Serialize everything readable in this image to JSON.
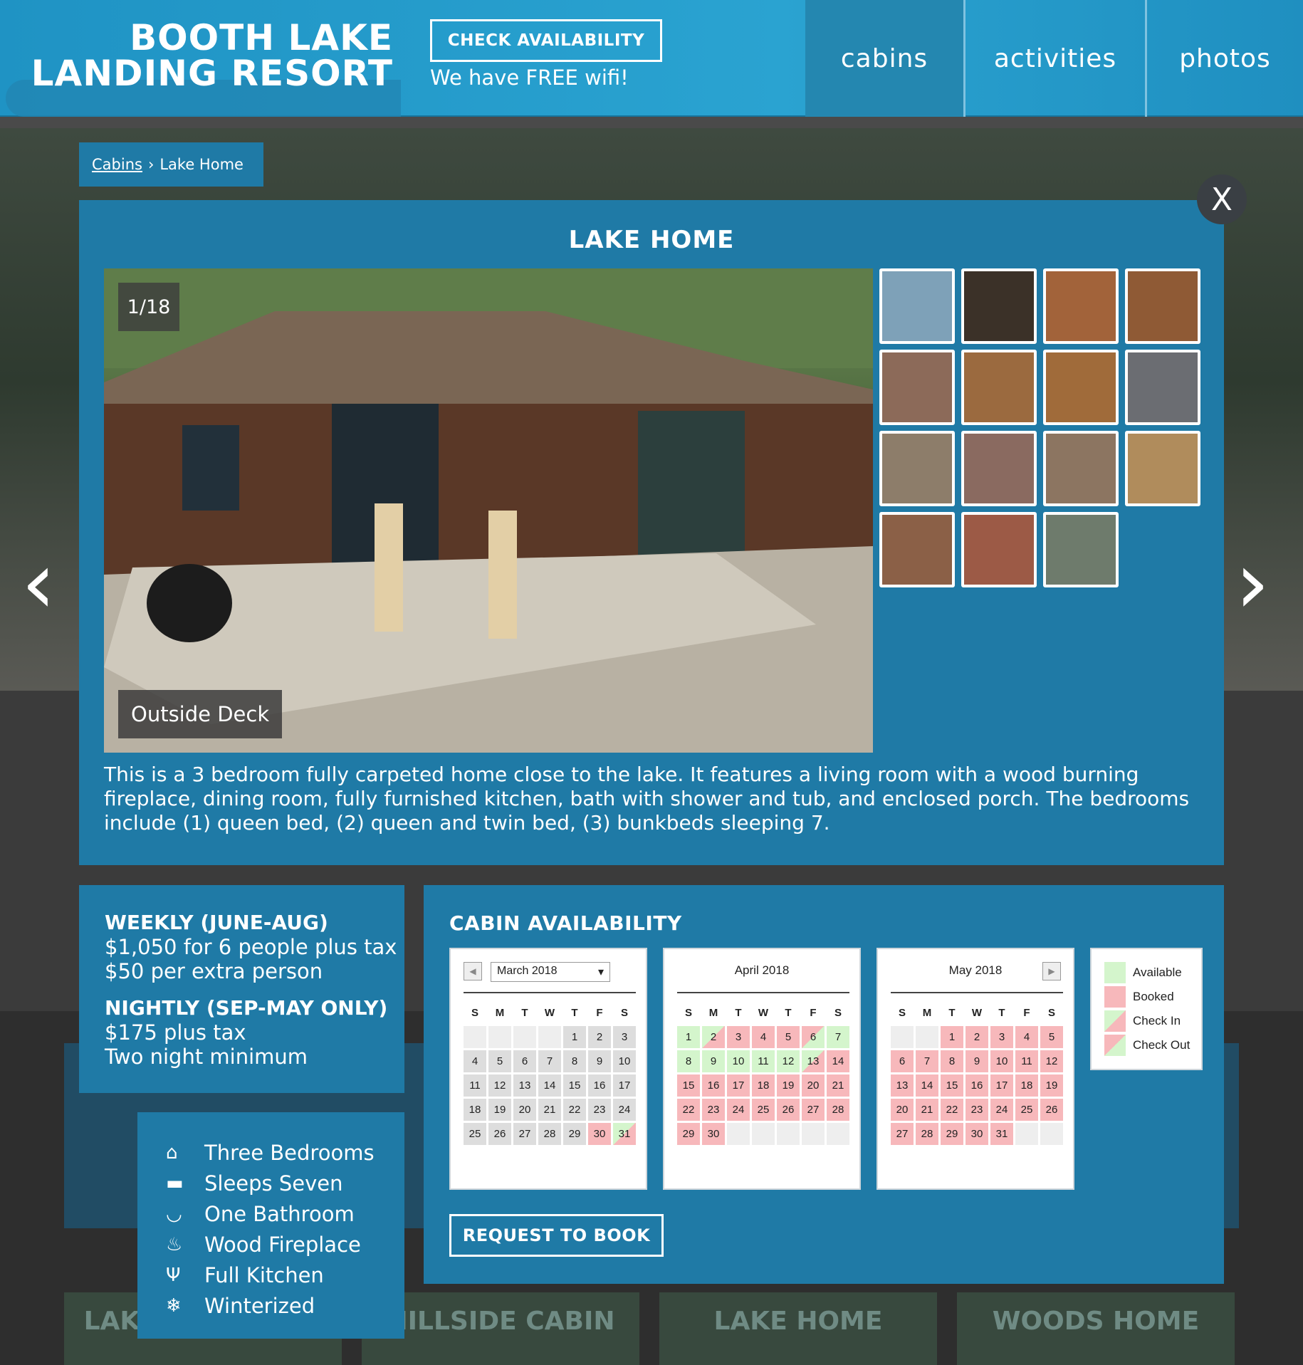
{
  "header": {
    "logo_line1": "BOOTH LAKE",
    "logo_line2": "LANDING RESORT",
    "check_availability": "CHECK AVAILABILITY",
    "wifi": "We have FREE wifi!",
    "nav": [
      {
        "label": "cabins",
        "active": true
      },
      {
        "label": "activities",
        "active": false
      },
      {
        "label": "photos",
        "active": false
      }
    ]
  },
  "breadcrumb": {
    "parent": "Cabins",
    "separator": "›",
    "current": "Lake Home"
  },
  "lightbox": {
    "close_label": "X",
    "title": "LAKE HOME",
    "counter": "1/18",
    "caption": "Outside Deck",
    "description": "This is a 3 bedroom fully carpeted home close to the lake. It features a living room with a wood burning fireplace, dining room, fully furnished kitchen, bath with shower and tub, and enclosed porch. The bedrooms include (1) queen bed, (2) queen and twin bed, (3) bunkbeds sleeping 7.",
    "prev_arrow": "‹",
    "next_arrow": "›",
    "thumbnails": [
      {
        "color": "#7ea1b8"
      },
      {
        "color": "#3b3128"
      },
      {
        "color": "#a2633a"
      },
      {
        "color": "#8f5a35"
      },
      {
        "color": "#8c6a59"
      },
      {
        "color": "#9b6a3f"
      },
      {
        "color": "#a06b3a"
      },
      {
        "color": "#6b6d72"
      },
      {
        "color": "#8d7d6a"
      },
      {
        "color": "#8a6a60"
      },
      {
        "color": "#8c7561"
      },
      {
        "color": "#b08c5c"
      },
      {
        "color": "#8b6047"
      },
      {
        "color": "#9c5a46"
      },
      {
        "color": "#6e7b6c"
      }
    ]
  },
  "rates": {
    "weekly_header": "WEEKLY (JUNE-AUG)",
    "weekly_line1": "$1,050 for 6 people plus tax",
    "weekly_line2": "$50 per extra person",
    "nightly_header": "NIGHTLY (SEP-MAY ONLY)",
    "nightly_line1": "$175 plus tax",
    "nightly_line2": "Two night minimum"
  },
  "features": [
    {
      "icon": "home-icon",
      "glyph": "⌂",
      "label": "Three Bedrooms"
    },
    {
      "icon": "bed-icon",
      "glyph": "▬",
      "label": "Sleeps Seven"
    },
    {
      "icon": "bathtub-icon",
      "glyph": "◡",
      "label": "One Bathroom"
    },
    {
      "icon": "fire-icon",
      "glyph": "♨",
      "label": "Wood Fireplace"
    },
    {
      "icon": "utensils-icon",
      "glyph": "Ψ",
      "label": "Full Kitchen"
    },
    {
      "icon": "snowflake-icon",
      "glyph": "❄",
      "label": "Winterized"
    }
  ],
  "availability": {
    "title": "CABIN AVAILABILITY",
    "request_button": "REQUEST TO BOOK",
    "weekday_labels": [
      "S",
      "M",
      "T",
      "W",
      "T",
      "F",
      "S"
    ],
    "calendars": [
      {
        "month": "March 2018",
        "cells": [
          [
            "",
            "e"
          ],
          [
            "",
            "e"
          ],
          [
            "",
            "e"
          ],
          [
            "",
            "e"
          ],
          [
            "1",
            "x"
          ],
          [
            "2",
            "x"
          ],
          [
            "3",
            "x"
          ],
          [
            "4",
            "x"
          ],
          [
            "5",
            "x"
          ],
          [
            "6",
            "x"
          ],
          [
            "7",
            "x"
          ],
          [
            "8",
            "x"
          ],
          [
            "9",
            "x"
          ],
          [
            "10",
            "x"
          ],
          [
            "11",
            "x"
          ],
          [
            "12",
            "x"
          ],
          [
            "13",
            "x"
          ],
          [
            "14",
            "x"
          ],
          [
            "15",
            "x"
          ],
          [
            "16",
            "x"
          ],
          [
            "17",
            "x"
          ],
          [
            "18",
            "x"
          ],
          [
            "19",
            "x"
          ],
          [
            "20",
            "x"
          ],
          [
            "21",
            "x"
          ],
          [
            "22",
            "x"
          ],
          [
            "23",
            "x"
          ],
          [
            "24",
            "x"
          ],
          [
            "25",
            "x"
          ],
          [
            "26",
            "x"
          ],
          [
            "27",
            "x"
          ],
          [
            "28",
            "x"
          ],
          [
            "29",
            "x"
          ],
          [
            "30",
            "b"
          ],
          [
            "31",
            "i"
          ]
        ]
      },
      {
        "month": "April 2018",
        "cells": [
          [
            "1",
            "a"
          ],
          [
            "2",
            "i"
          ],
          [
            "3",
            "b"
          ],
          [
            "4",
            "b"
          ],
          [
            "5",
            "b"
          ],
          [
            "6",
            "o"
          ],
          [
            "7",
            "a"
          ],
          [
            "8",
            "a"
          ],
          [
            "9",
            "a"
          ],
          [
            "10",
            "a"
          ],
          [
            "11",
            "a"
          ],
          [
            "12",
            "a"
          ],
          [
            "13",
            "i"
          ],
          [
            "14",
            "b"
          ],
          [
            "15",
            "b"
          ],
          [
            "16",
            "b"
          ],
          [
            "17",
            "b"
          ],
          [
            "18",
            "b"
          ],
          [
            "19",
            "b"
          ],
          [
            "20",
            "b"
          ],
          [
            "21",
            "b"
          ],
          [
            "22",
            "b"
          ],
          [
            "23",
            "b"
          ],
          [
            "24",
            "b"
          ],
          [
            "25",
            "b"
          ],
          [
            "26",
            "b"
          ],
          [
            "27",
            "b"
          ],
          [
            "28",
            "b"
          ],
          [
            "29",
            "b"
          ],
          [
            "30",
            "b"
          ],
          [
            "",
            "e"
          ],
          [
            "",
            "e"
          ],
          [
            "",
            "e"
          ],
          [
            "",
            "e"
          ],
          [
            "",
            "e"
          ]
        ]
      },
      {
        "month": "May 2018",
        "cells": [
          [
            "",
            "e"
          ],
          [
            "",
            "e"
          ],
          [
            "1",
            "b"
          ],
          [
            "2",
            "b"
          ],
          [
            "3",
            "b"
          ],
          [
            "4",
            "b"
          ],
          [
            "5",
            "b"
          ],
          [
            "6",
            "b"
          ],
          [
            "7",
            "b"
          ],
          [
            "8",
            "b"
          ],
          [
            "9",
            "b"
          ],
          [
            "10",
            "b"
          ],
          [
            "11",
            "b"
          ],
          [
            "12",
            "b"
          ],
          [
            "13",
            "b"
          ],
          [
            "14",
            "b"
          ],
          [
            "15",
            "b"
          ],
          [
            "16",
            "b"
          ],
          [
            "17",
            "b"
          ],
          [
            "18",
            "b"
          ],
          [
            "19",
            "b"
          ],
          [
            "20",
            "b"
          ],
          [
            "21",
            "b"
          ],
          [
            "22",
            "b"
          ],
          [
            "23",
            "b"
          ],
          [
            "24",
            "b"
          ],
          [
            "25",
            "b"
          ],
          [
            "26",
            "b"
          ],
          [
            "27",
            "b"
          ],
          [
            "28",
            "b"
          ],
          [
            "29",
            "b"
          ],
          [
            "30",
            "b"
          ],
          [
            "31",
            "b"
          ],
          [
            "",
            "e"
          ],
          [
            "",
            "e"
          ]
        ]
      }
    ],
    "legend": [
      {
        "label": "Available",
        "color": "#d4f5cc"
      },
      {
        "label": "Booked",
        "color": "#f7b8bb"
      },
      {
        "label": "Check In",
        "color": "checkin"
      },
      {
        "label": "Check Out",
        "color": "checkout"
      }
    ]
  },
  "background_cards": [
    "LAKESIDE CABIN",
    "HILLSIDE CABIN",
    "LAKE HOME",
    "WOODS HOME"
  ]
}
